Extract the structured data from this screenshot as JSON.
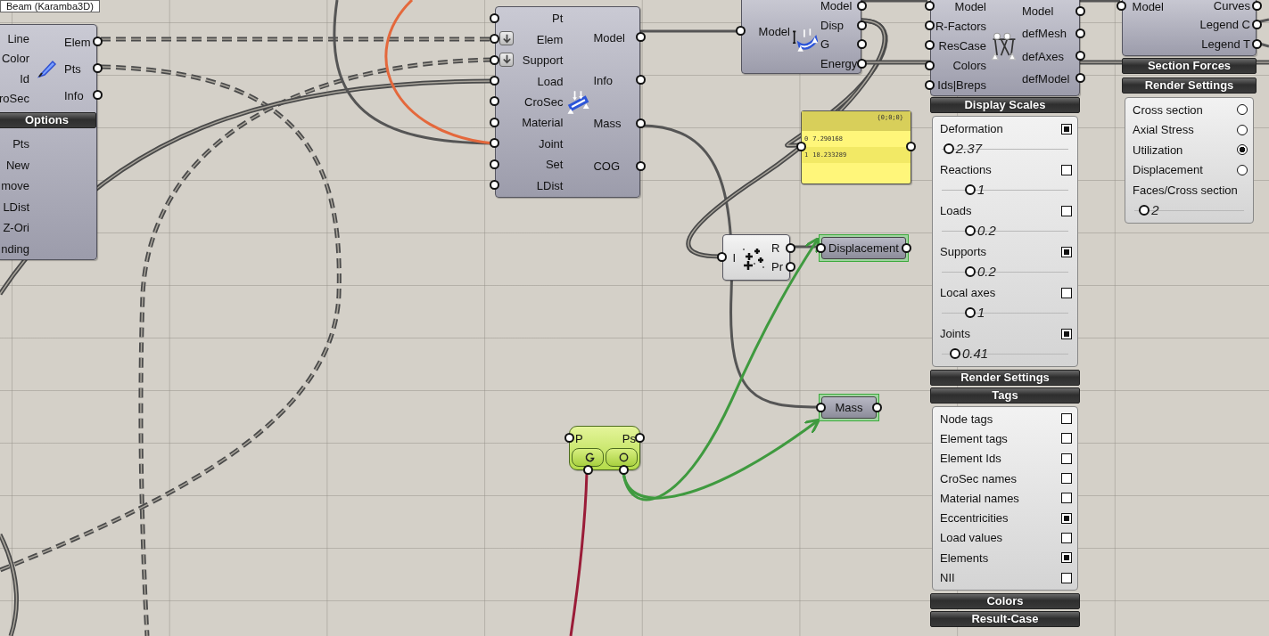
{
  "tooltip": "Beam (Karamba3D)",
  "beam_component": {
    "inputs": [
      "Line",
      "Color",
      "Id",
      "roSec"
    ],
    "outputs": [
      "Elem",
      "Pts",
      "Info"
    ],
    "section": "Options",
    "options": [
      "Pts",
      "New",
      "move",
      "LDist",
      "Z-Ori",
      "nding"
    ]
  },
  "assemble_component": {
    "inputs": [
      {
        "label": "Pt",
        "flatten": false
      },
      {
        "label": "Elem",
        "flatten": true
      },
      {
        "label": "Support",
        "flatten": true
      },
      {
        "label": "Load",
        "flatten": false
      },
      {
        "label": "CroSec",
        "flatten": false
      },
      {
        "label": "Material",
        "flatten": false
      },
      {
        "label": "Joint",
        "flatten": false
      },
      {
        "label": "Set",
        "flatten": false
      },
      {
        "label": "LDist",
        "flatten": false
      }
    ],
    "outputs": [
      "Model",
      "Info",
      "Mass",
      "COG"
    ]
  },
  "analyze_component": {
    "inputs": [
      "Model"
    ],
    "outputs": [
      "Model",
      "Disp",
      "G",
      "Energy"
    ]
  },
  "panel": {
    "header": "{0;0;0}",
    "rows": [
      {
        "index": "0",
        "value": "7.290168"
      },
      {
        "index": "1",
        "value": "18.233289"
      }
    ]
  },
  "model_view": {
    "inputs": [
      "Model",
      "R-Factors",
      "ResCase",
      "Colors",
      "Ids|Breps"
    ],
    "outputs": [
      "Model",
      "defMesh",
      "defAxes",
      "defModel"
    ],
    "sections": [
      {
        "title": "Display Scales",
        "items": [
          {
            "kind": "scale",
            "label": "Deformation",
            "checked": true,
            "value": "2.37",
            "level": 0.02
          },
          {
            "kind": "scale",
            "label": "Reactions",
            "checked": false,
            "value": "1",
            "level": 0.19
          },
          {
            "kind": "scale",
            "label": "Loads",
            "checked": false,
            "value": "0.2",
            "level": 0.19
          },
          {
            "kind": "scale",
            "label": "Supports",
            "checked": true,
            "value": "0.2",
            "level": 0.19
          },
          {
            "kind": "scale",
            "label": "Local axes",
            "checked": false,
            "value": "1",
            "level": 0.19
          },
          {
            "kind": "scale",
            "label": "Joints",
            "checked": true,
            "value": "0.41",
            "level": 0.07
          }
        ]
      },
      {
        "title": "Render Settings"
      },
      {
        "title": "Tags",
        "items": [
          {
            "kind": "check",
            "label": "Node tags",
            "checked": false
          },
          {
            "kind": "check",
            "label": "Element tags",
            "checked": false
          },
          {
            "kind": "check",
            "label": "Element Ids",
            "checked": false
          },
          {
            "kind": "check",
            "label": "CroSec names",
            "checked": false
          },
          {
            "kind": "check",
            "label": "Material names",
            "checked": false
          },
          {
            "kind": "check",
            "label": "Eccentricities",
            "checked": true
          },
          {
            "kind": "check",
            "label": "Load values",
            "checked": false
          },
          {
            "kind": "check",
            "label": "Elements",
            "checked": true
          },
          {
            "kind": "check",
            "label": "NII",
            "checked": false
          }
        ]
      },
      {
        "title": "Colors"
      },
      {
        "title": "Result-Case"
      }
    ]
  },
  "beam_view": {
    "inputs": [
      "Model"
    ],
    "outputs": [
      "Curves",
      "Legend C",
      "Legend T"
    ],
    "sections": [
      {
        "title": "Section Forces"
      },
      {
        "title": "Render Settings",
        "items": [
          {
            "kind": "radio",
            "label": "Cross section",
            "selected": false
          },
          {
            "kind": "radio",
            "label": "Axial Stress",
            "selected": false
          },
          {
            "kind": "radio",
            "label": "Utilization",
            "selected": true
          },
          {
            "kind": "radio",
            "label": "Displacement",
            "selected": false
          },
          {
            "kind": "slider",
            "label": "Faces/Cross section",
            "value": "2",
            "level": 0.05
          }
        ]
      }
    ]
  },
  "tree_component": {
    "inputs": [
      "I"
    ],
    "outputs": [
      "R",
      "Pr"
    ]
  },
  "params": [
    {
      "label": "Displacement"
    },
    {
      "label": "Mass"
    }
  ],
  "gate_component": {
    "inputs": [
      "P"
    ],
    "outputs": [
      "Ps"
    ]
  }
}
